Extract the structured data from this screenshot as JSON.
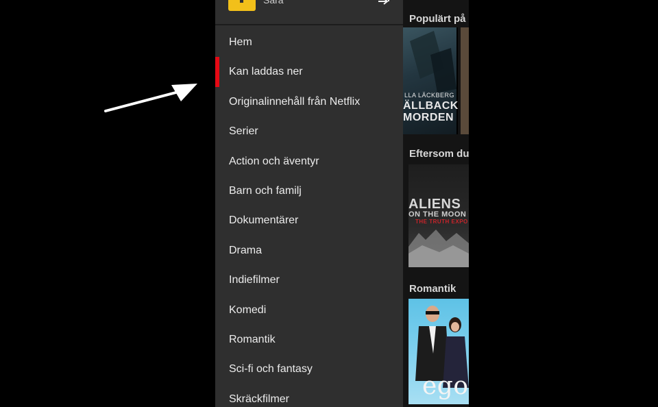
{
  "profile": {
    "name": "Sara",
    "avatar_color": "#f2c01a",
    "switch_icon": "switch-profile-arrow-icon"
  },
  "menu": {
    "items": [
      {
        "label": "Hem"
      },
      {
        "label": "Kan laddas ner",
        "active": true
      },
      {
        "label": "Originalinnehåll från Netflix"
      },
      {
        "label": "Serier"
      },
      {
        "label": "Action och äventyr"
      },
      {
        "label": "Barn och familj"
      },
      {
        "label": "Dokumentärer"
      },
      {
        "label": "Drama"
      },
      {
        "label": "Indiefilmer"
      },
      {
        "label": "Komedi"
      },
      {
        "label": "Romantik"
      },
      {
        "label": "Sci-fi och fantasy"
      },
      {
        "label": "Skräckfilmer"
      }
    ],
    "active_indicator_color": "#e50914"
  },
  "background": {
    "rows": [
      {
        "title": "Populärt på",
        "poster_text": [
          "LLA LÄCKBERG",
          "ÄLLBACKA",
          "MORDEN"
        ]
      },
      {
        "title": "Eftersom du",
        "poster_text": [
          "ALIENS",
          "ON THE MOON",
          "THE TRUTH EXPO"
        ]
      },
      {
        "title": "Romantik",
        "poster_text": [
          "ego"
        ]
      }
    ]
  },
  "annotation": {
    "icon": "pointer-arrow-icon",
    "color": "#ffffff"
  }
}
